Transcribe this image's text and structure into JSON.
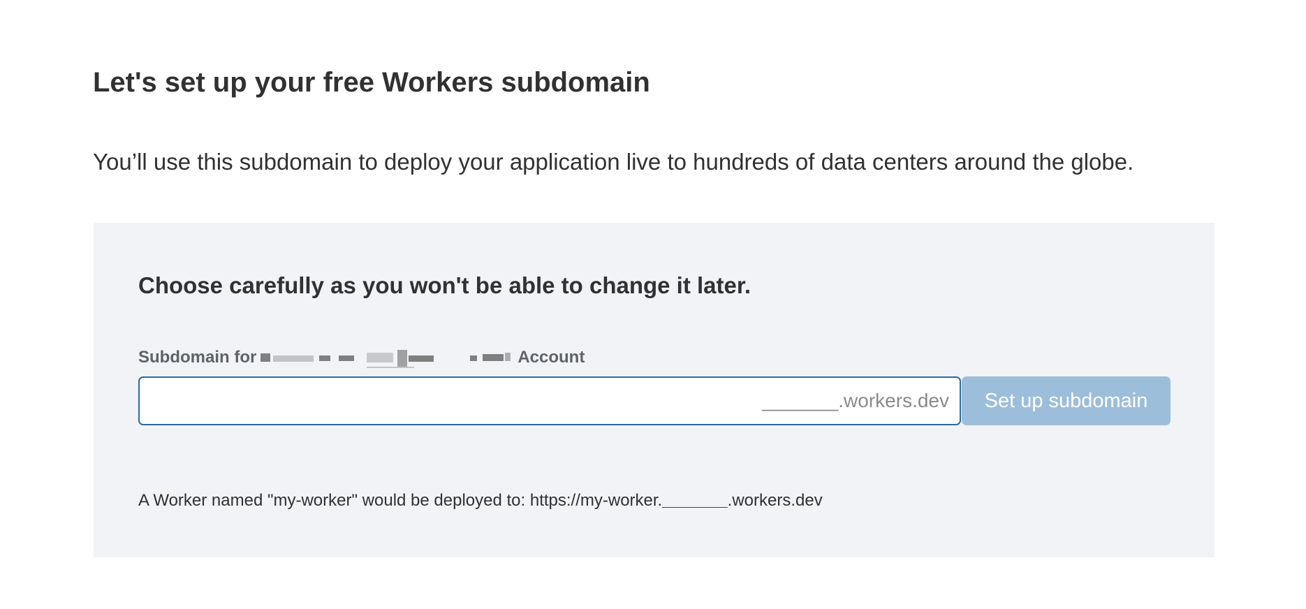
{
  "title": "Let's set up your free Workers subdomain",
  "intro": "You’ll use this subdomain to deploy your application live to hundreds of data centers around the globe.",
  "panel": {
    "heading": "Choose carefully as you won't be able to change it later.",
    "label_prefix": "Subdomain for",
    "label_suffix": "Account",
    "input": {
      "value": "",
      "placeholder": "",
      "suffix": "_______.workers.dev"
    },
    "submit_label": "Set up subdomain",
    "note_prefix": "A Worker named \"my-worker\" would be deployed to: https://my-worker.",
    "note_blank": "_______",
    "note_suffix": ".workers.dev"
  },
  "colors": {
    "panel_background": "#f1f3f7",
    "input_border": "#2b6aa0",
    "button_disabled": "#9cbedb"
  }
}
